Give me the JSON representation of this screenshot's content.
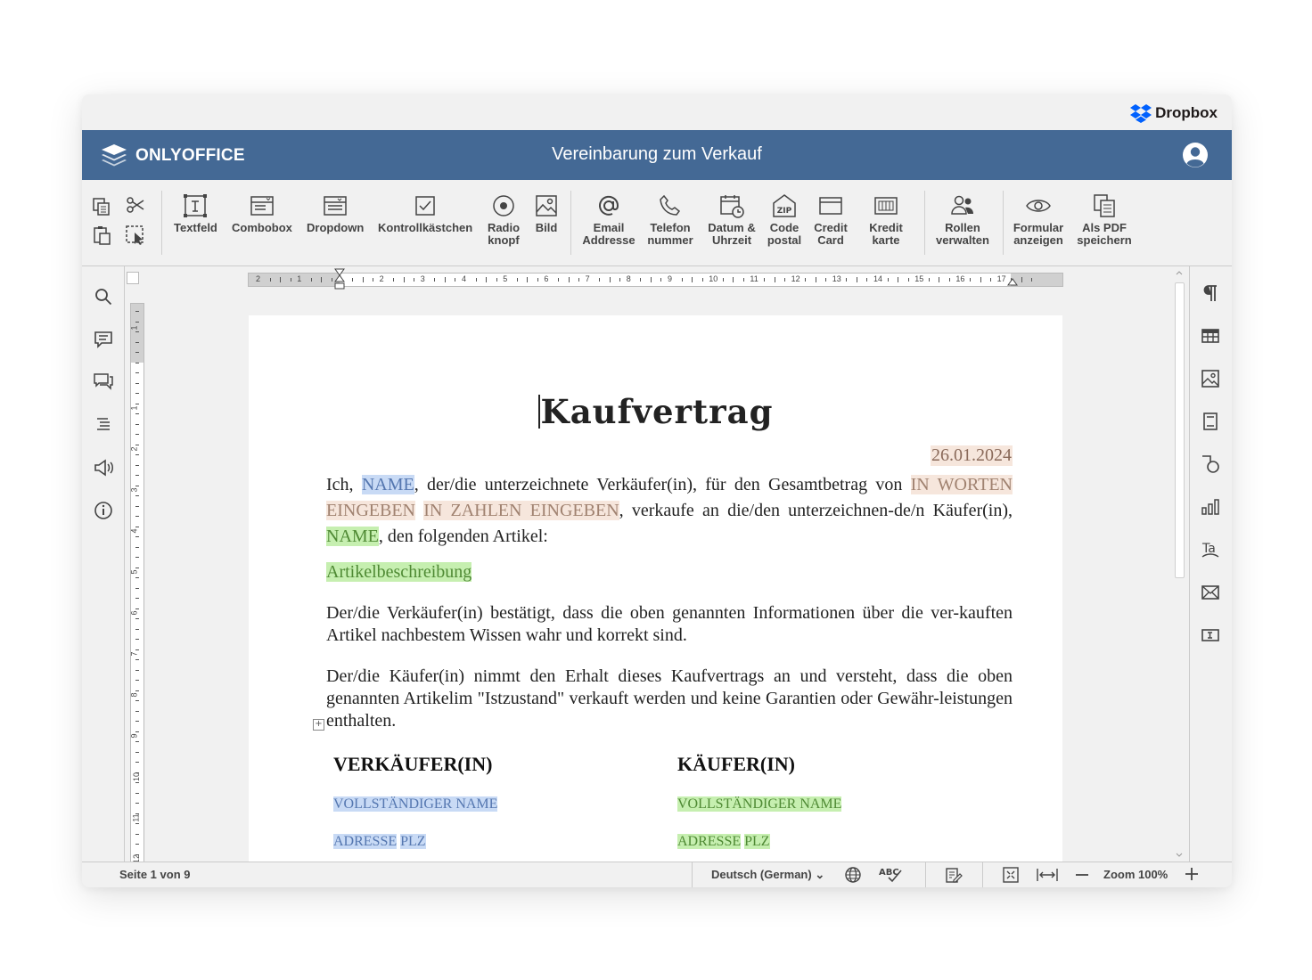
{
  "dropbox": {
    "label": "Dropbox"
  },
  "app": {
    "brand": "ONLYOFFICE",
    "doc_title": "Vereinbarung zum Verkauf"
  },
  "toolbar": {
    "buttons": [
      {
        "label": "Textfeld",
        "icon": "text-field-icon"
      },
      {
        "label": "Combobox",
        "icon": "combobox-icon"
      },
      {
        "label": "Dropdown",
        "icon": "dropdown-icon"
      },
      {
        "label": "Kontrollkästchen",
        "icon": "checkbox-icon"
      },
      {
        "label": "Radio knopf",
        "icon": "radio-button-icon"
      },
      {
        "label": "Bild",
        "icon": "image-icon"
      },
      {
        "label": "Email Addresse",
        "icon": "at-icon"
      },
      {
        "label": "Telefon nummer",
        "icon": "phone-icon"
      },
      {
        "label": "Datum & Uhrzeit",
        "icon": "calendar-clock-icon"
      },
      {
        "label": "Code postal",
        "icon": "zip-icon"
      },
      {
        "label": "Credit Card",
        "icon": "credit-card-icon"
      },
      {
        "label": "Kredit karte",
        "icon": "kredit-karte-icon"
      },
      {
        "label": "Rollen verwalten",
        "icon": "roles-icon"
      },
      {
        "label": "Formular anzeigen",
        "icon": "eye-icon"
      },
      {
        "label": "Als PDF speichern",
        "icon": "save-pdf-icon"
      }
    ]
  },
  "ruler": {
    "h_numbers": [
      "2",
      "1",
      "1",
      "2",
      "3",
      "4",
      "5",
      "6",
      "7",
      "8",
      "9",
      "10",
      "11",
      "12",
      "13",
      "14",
      "15",
      "16",
      "17"
    ],
    "v_numbers": [
      "1",
      "1",
      "2",
      "3",
      "4",
      "5",
      "6",
      "7",
      "8",
      "9",
      "10",
      "11",
      "12"
    ]
  },
  "document": {
    "title": "Kaufvertrag",
    "date": "26.01.2024",
    "p1": {
      "a": "Ich, ",
      "name1": "NAME",
      "b": ", der/die  unterzeichnete Verkäufer(in), für den Gesamtbetrag von ",
      "in_words": "IN WORTEN EINGEBEN",
      "in_numbers": "IN ZAHLEN EINGEBEN",
      "c": ", verkaufe an die/den unterzeichnen-de/n Käufer(in), ",
      "name2": "NAME",
      "d": ", den folgenden Artikel:"
    },
    "article": "Artikelbeschreibung",
    "p2": "Der/die Verkäufer(in) bestätigt, dass die oben genannten Informationen über die ver-kauften Artikel nachbestem Wissen wahr und korrekt sind.",
    "p3": "Der/die Käufer(in) nimmt den Erhalt dieses Kaufvertrags an und versteht, dass die oben genannten Artikelim \"Istzustand\" verkauft werden und keine Garantien oder Gewähr-leistungen enthalten.",
    "seller": {
      "head": "VERKÄUFER(IN)",
      "full_name": "VOLLSTÄNDIGER NAME",
      "address": "ADRESSE",
      "zip": "PLZ"
    },
    "buyer": {
      "head": "KÄUFER(IN)",
      "full_name": "VOLLSTÄNDIGER NAME",
      "address": "ADRESSE",
      "zip": "PLZ"
    }
  },
  "status": {
    "page": "Seite 1 von 9",
    "language": "Deutsch (German)",
    "zoom": "Zoom 100%"
  },
  "colors": {
    "header": "#446995",
    "field_blue": "#c8daf5",
    "field_orange": "#f6e6dc",
    "field_green": "#c6efb0"
  }
}
